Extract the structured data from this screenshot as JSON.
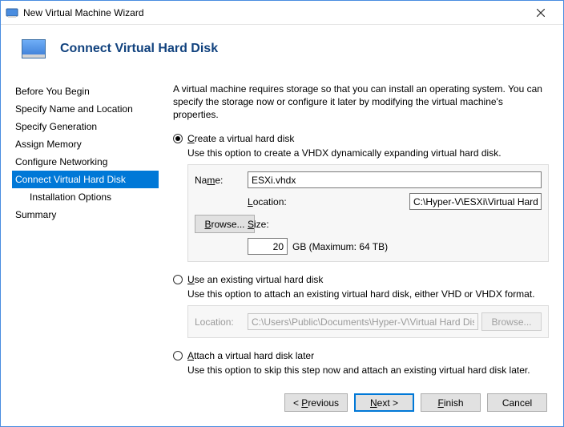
{
  "window": {
    "title": "New Virtual Machine Wizard"
  },
  "header": {
    "title": "Connect Virtual Hard Disk"
  },
  "sidebar": {
    "items": [
      {
        "label": "Before You Begin"
      },
      {
        "label": "Specify Name and Location"
      },
      {
        "label": "Specify Generation"
      },
      {
        "label": "Assign Memory"
      },
      {
        "label": "Configure Networking"
      },
      {
        "label": "Connect Virtual Hard Disk"
      },
      {
        "label": "Installation Options"
      },
      {
        "label": "Summary"
      }
    ]
  },
  "content": {
    "intro": "A virtual machine requires storage so that you can install an operating system. You can specify the storage now or configure it later by modifying the virtual machine's properties.",
    "create": {
      "label": "Create a virtual hard disk",
      "desc": "Use this option to create a VHDX dynamically expanding virtual hard disk.",
      "name_label": "Name:",
      "name_value": "ESXi.vhdx",
      "location_label": "Location:",
      "location_value": "C:\\Hyper-V\\ESXi\\Virtual Hard Disks\\",
      "browse": "Browse...",
      "size_label": "Size:",
      "size_value": "20",
      "size_suffix": "GB (Maximum: 64 TB)"
    },
    "existing": {
      "label": "Use an existing virtual hard disk",
      "desc": "Use this option to attach an existing virtual hard disk, either VHD or VHDX format.",
      "location_label": "Location:",
      "location_value": "C:\\Users\\Public\\Documents\\Hyper-V\\Virtual Hard Disks\\",
      "browse": "Browse..."
    },
    "later": {
      "label": "Attach a virtual hard disk later",
      "desc": "Use this option to skip this step now and attach an existing virtual hard disk later."
    }
  },
  "footer": {
    "previous": "< Previous",
    "next": "Next >",
    "finish": "Finish",
    "cancel": "Cancel"
  }
}
